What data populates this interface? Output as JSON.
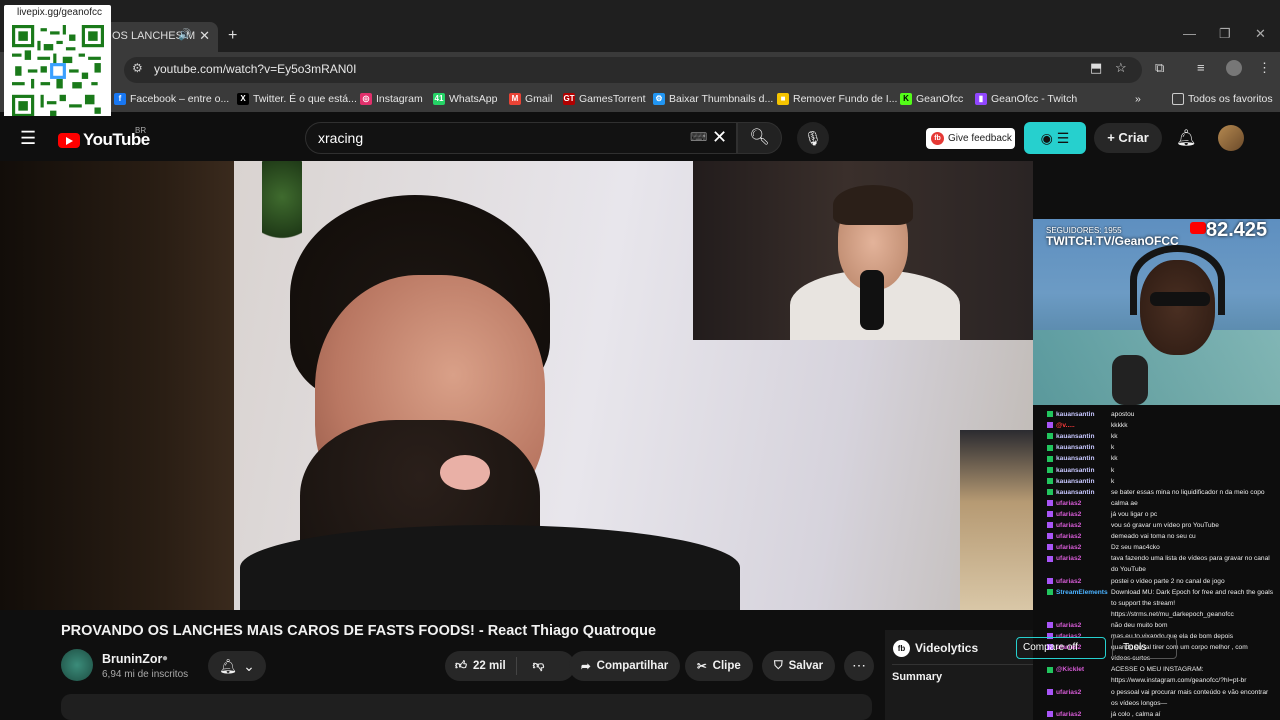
{
  "browser": {
    "tab_title": "OS LANCHES M",
    "tab_audio_icon": "speaker-icon",
    "url": "youtube.com/watch?v=Ey5o3mRAN0I",
    "bookmarks": [
      {
        "label": "Facebook – entre o...",
        "icon": "f",
        "color": "#1877f2"
      },
      {
        "label": "Twitter. É o que está...",
        "icon": "X",
        "color": "#000000"
      },
      {
        "label": "Instagram",
        "icon": "◎",
        "color": "#e1306c"
      },
      {
        "label": "WhatsApp",
        "icon": "41",
        "color": "#25d366"
      },
      {
        "label": "Gmail",
        "icon": "M",
        "color": "#ea4335"
      },
      {
        "label": "GamesTorrent",
        "icon": "GT",
        "color": "#b00000"
      },
      {
        "label": "Baixar Thumbnails d...",
        "icon": "⚙",
        "color": "#2196f3"
      },
      {
        "label": "Remover Fundo de I...",
        "icon": "■",
        "color": "#f5c400"
      },
      {
        "label": "GeanOfcc",
        "icon": "K",
        "color": "#53fc18"
      },
      {
        "label": "GeanOfcc - Twitch",
        "icon": "▮",
        "color": "#9146ff"
      }
    ],
    "all_favorites": "Todos os favoritos"
  },
  "qr": {
    "url_text": "livepix.gg/geanofcc"
  },
  "youtube": {
    "country": "BR",
    "logo_text": "YouTube",
    "search_value": "xracing",
    "feedback_label": "Give feedback",
    "create_label": "Criar"
  },
  "webcam": {
    "followers": "SEGUIDORES: 1955",
    "twitch": "TWITCH.TV/GeanOFCC",
    "count": "82.425"
  },
  "chat": [
    {
      "user": "kauansantin",
      "text": "apostou",
      "badge": "g",
      "color": "u"
    },
    {
      "user": "@v.....",
      "text": "kkkkk",
      "badge": "p",
      "color": "u red"
    },
    {
      "user": "kauansantin",
      "text": "kk",
      "badge": "g",
      "color": "u"
    },
    {
      "user": "kauansantin",
      "text": "k",
      "badge": "g",
      "color": "u"
    },
    {
      "user": "kauansantin",
      "text": "kk",
      "badge": "g",
      "color": "u"
    },
    {
      "user": "kauansantin",
      "text": "k",
      "badge": "g",
      "color": "u"
    },
    {
      "user": "kauansantin",
      "text": "k",
      "badge": "g",
      "color": "u"
    },
    {
      "user": "kauansantin",
      "text": "se bater essas mina no liquidificador n da meio copo",
      "badge": "g",
      "color": "u"
    },
    {
      "user": "ufarias2",
      "text": "calma ae",
      "badge": "p",
      "color": "u pink"
    },
    {
      "user": "ufarias2",
      "text": "já vou ligar o pc",
      "badge": "p",
      "color": "u pink"
    },
    {
      "user": "ufarias2",
      "text": "vou só gravar um vídeo pro YouTube",
      "badge": "p",
      "color": "u pink"
    },
    {
      "user": "ufarias2",
      "text": "demeado vai toma no seu cu",
      "badge": "p",
      "color": "u pink"
    },
    {
      "user": "ufarias2",
      "text": "Dz seu mac4cko",
      "badge": "p",
      "color": "u pink"
    },
    {
      "user": "ufarias2",
      "text": "tava fazendo uma lista de vídeos para gravar no canal",
      "badge": "p",
      "color": "u pink"
    },
    {
      "user": "",
      "text": "do YouTube",
      "badge": "",
      "color": "u"
    },
    {
      "user": "ufarias2",
      "text": "postei o vídeo parte 2 no canal de jogo",
      "badge": "p",
      "color": "u pink"
    },
    {
      "user": "StreamElements",
      "text": "Download MU: Dark Epoch for free and reach the goals",
      "badge": "g",
      "color": "u blue"
    },
    {
      "user": "",
      "text": "to support the stream!",
      "badge": "",
      "color": "u"
    },
    {
      "user": "",
      "text": "https://strms.net/mu_darkepoch_geanofcc",
      "badge": "",
      "color": "u"
    },
    {
      "user": "ufarias2",
      "text": "não deu muito bom",
      "badge": "p",
      "color": "u pink"
    },
    {
      "user": "ufarias2",
      "text": "mas eu to vixando que ela de bom depois",
      "badge": "p",
      "color": "u pink"
    },
    {
      "user": "ufarias2",
      "text": "quando eu tal tirer com um corpo melhor , com",
      "badge": "p",
      "color": "u pink"
    },
    {
      "user": "",
      "text": "vídeos curtos",
      "badge": "",
      "color": "u"
    },
    {
      "user": "@Kicklet",
      "text": "ACESSE O MEU INSTAGRAM:",
      "badge": "g",
      "color": "u pink"
    },
    {
      "user": "",
      "text": "https://www.instagram.com/geanofcc/?hl=pt-br",
      "badge": "",
      "color": "u"
    },
    {
      "user": "ufarias2",
      "text": "o pessoal vai procurar mais conteúdo e vão encontrar",
      "badge": "p",
      "color": "u pink"
    },
    {
      "user": "",
      "text": "os vídeos longos—",
      "badge": "",
      "color": "u"
    },
    {
      "user": "ufarias2",
      "text": "já colo , calma aí",
      "badge": "p",
      "color": "u pink"
    }
  ],
  "video": {
    "title": "PROVANDO OS LANCHES MAIS CAROS DE FASTS FOODS! - React Thiago Quatroque",
    "channel": "BruninZor",
    "subscribers": "6,94 mi de inscritos",
    "likes": "22 mil",
    "share_label": "Compartilhar",
    "clip_label": "Clipe",
    "save_label": "Salvar"
  },
  "videolytics": {
    "title": "Videolytics",
    "summary": "Summary",
    "compare": "Compare",
    "compare_state": "off",
    "tools": "Tools"
  }
}
